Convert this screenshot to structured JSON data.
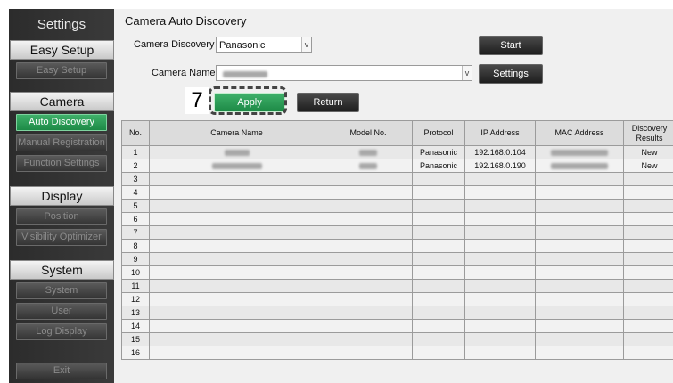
{
  "sidebar": {
    "title": "Settings",
    "sections": [
      {
        "heading": "Easy Setup",
        "items": [
          "Easy Setup"
        ]
      },
      {
        "heading": "Camera",
        "items": [
          "Auto Discovery",
          "Manual Registration",
          "Function Settings"
        ]
      },
      {
        "heading": "Display",
        "items": [
          "Position",
          "Visibility Optimizer"
        ]
      },
      {
        "heading": "System",
        "items": [
          "System",
          "User",
          "Log Display"
        ]
      }
    ],
    "exit_label": "Exit",
    "active_item": "Auto Discovery",
    "accent_color": "#2e9c56"
  },
  "main": {
    "title": "Camera Auto Discovery",
    "discovery_label": "Camera Discovery",
    "discovery_value": "Panasonic",
    "camera_name_label": "Camera Name",
    "camera_name_value": "",
    "start_label": "Start",
    "settings_label": "Settings",
    "apply_label": "Apply",
    "return_label": "Return",
    "callout_number": "7"
  },
  "table": {
    "columns": [
      "No.",
      "Camera Name",
      "Model No.",
      "Protocol",
      "IP Address",
      "MAC Address",
      "Discovery Results"
    ],
    "rows": [
      {
        "no": "1",
        "protocol": "Panasonic",
        "ip": "192.168.0.104",
        "result": "New"
      },
      {
        "no": "2",
        "protocol": "Panasonic",
        "ip": "192.168.0.190",
        "result": "New"
      },
      {
        "no": "3"
      },
      {
        "no": "4"
      },
      {
        "no": "5"
      },
      {
        "no": "6"
      },
      {
        "no": "7"
      },
      {
        "no": "8"
      },
      {
        "no": "9"
      },
      {
        "no": "10"
      },
      {
        "no": "11"
      },
      {
        "no": "12"
      },
      {
        "no": "13"
      },
      {
        "no": "14"
      },
      {
        "no": "15"
      },
      {
        "no": "16"
      }
    ]
  }
}
